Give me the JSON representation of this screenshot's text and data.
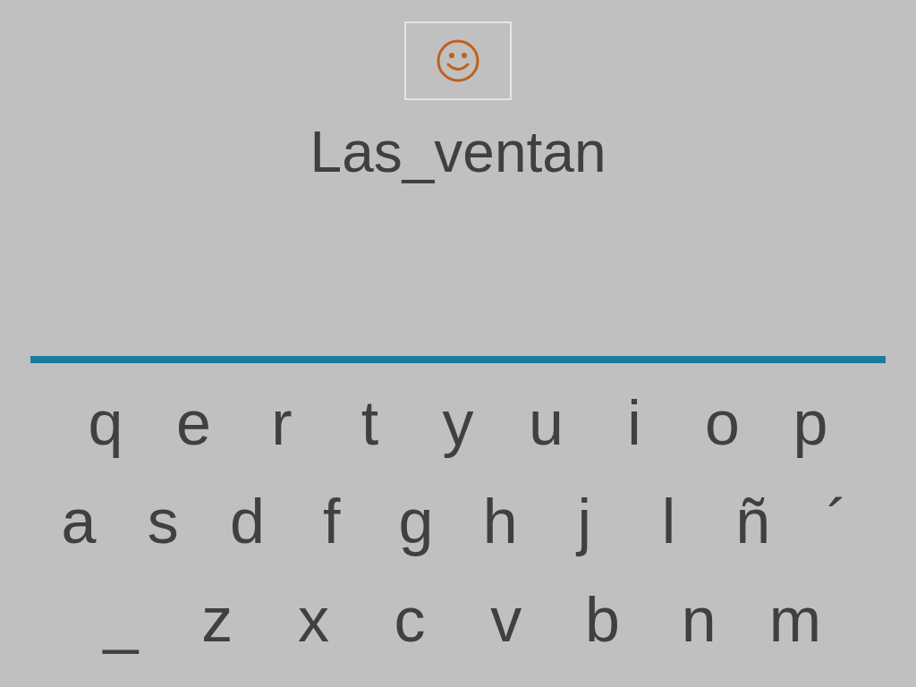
{
  "word": {
    "text": "Las_ventan"
  },
  "keyboard": {
    "rows": [
      [
        "q",
        "e",
        "r",
        "t",
        "y",
        "u",
        "i",
        "o",
        "p"
      ],
      [
        "a",
        "s",
        "d",
        "f",
        "g",
        "h",
        "j",
        "l",
        "ñ",
        "´"
      ],
      [
        "_",
        "z",
        "x",
        "c",
        "v",
        "b",
        "n",
        "m"
      ]
    ]
  }
}
